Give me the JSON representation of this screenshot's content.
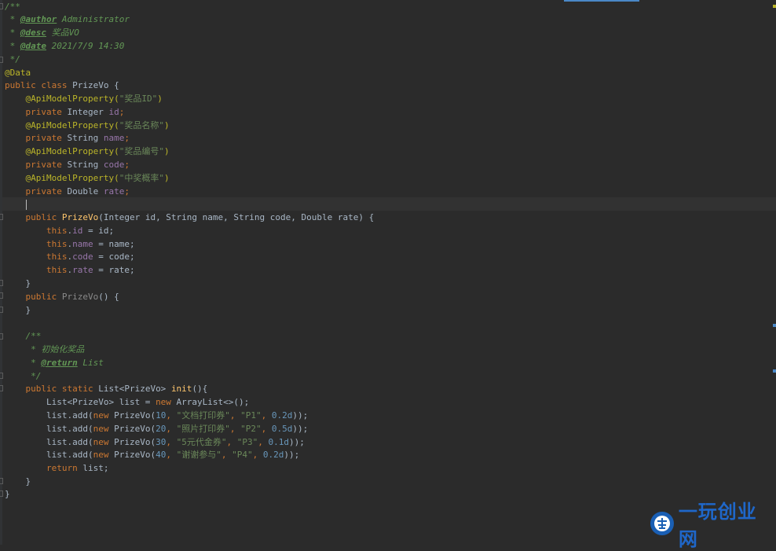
{
  "colors": {
    "background": "#2b2b2b",
    "comment": "#629755",
    "keyword": "#cc7832",
    "annotation": "#bbb529",
    "string": "#6a8759",
    "field": "#9876aa",
    "number": "#6897bb",
    "method": "#ffc66d",
    "text": "#a9b7c6"
  },
  "code": {
    "l1": "/**",
    "l2_prefix": " * ",
    "l2_tag": "@author",
    "l2_rest": " Administrator",
    "l3_prefix": " * ",
    "l3_tag": "@desc",
    "l3_rest": " 奖品VO",
    "l4_prefix": " * ",
    "l4_tag": "@date",
    "l4_rest": " 2021/7/9 14:30",
    "l5": " */",
    "l6": "@Data",
    "l7_kw": "public class",
    "l7_rest": " PrizeVo {",
    "l8_ann": "    @ApiModelProperty(",
    "l8_str": "\"奖品ID\"",
    "l8_end": ")",
    "l9_kw": "    private",
    "l9_type": " Integer ",
    "l9_field": "id",
    "l9_end": ";",
    "l10_ann": "    @ApiModelProperty(",
    "l10_str": "\"奖品名称\"",
    "l10_end": ")",
    "l11_kw": "    private",
    "l11_type": " String ",
    "l11_field": "name",
    "l11_end": ";",
    "l12_ann": "    @ApiModelProperty(",
    "l12_str": "\"奖品编号\"",
    "l12_end": ")",
    "l13_kw": "    private",
    "l13_type": " String ",
    "l13_field": "code",
    "l13_end": ";",
    "l14_ann": "    @ApiModelProperty(",
    "l14_str": "\"中奖概率\"",
    "l14_end": ")",
    "l15_kw": "    private",
    "l15_type": " Double ",
    "l15_field": "rate",
    "l15_end": ";",
    "l16_indent": "    ",
    "l17_kw": "    public ",
    "l17_fn": "PrizeVo",
    "l17_rest": "(Integer id, String name, String code, Double rate) {",
    "l18_kw": "        this",
    "l18_dot": ".",
    "l18_field": "id",
    "l18_rest": " = id;",
    "l19_kw": "        this",
    "l19_dot": ".",
    "l19_field": "name",
    "l19_rest": " = name;",
    "l20_kw": "        this",
    "l20_dot": ".",
    "l20_field": "code",
    "l20_rest": " = code;",
    "l21_kw": "        this",
    "l21_dot": ".",
    "l21_field": "rate",
    "l21_rest": " = rate;",
    "l22": "    }",
    "l23_kw": "    public ",
    "l23_fn": "PrizeVo",
    "l23_rest": "() {",
    "l24": "    }",
    "l26": "    /**",
    "l27": "     * 初始化奖品",
    "l28_prefix": "     * ",
    "l28_tag": "@return",
    "l28_rest": " List",
    "l29": "     */",
    "l30_kw": "    public static",
    "l30_type": " List<PrizeVo> ",
    "l30_fn": "init",
    "l30_rest": "(){",
    "l31_a": "        List<PrizeVo> list = ",
    "l31_kw": "new",
    "l31_b": " ArrayList<>();",
    "l32_a": "        list.add(",
    "l32_kw": "new",
    "l32_b": " PrizeVo(",
    "l32_n1": "10",
    "l32_c1": ", ",
    "l32_s1": "\"文档打印券\"",
    "l32_c2": ", ",
    "l32_s2": "\"P1\"",
    "l32_c3": ", ",
    "l32_n2": "0.2d",
    "l32_end": "));",
    "l33_a": "        list.add(",
    "l33_kw": "new",
    "l33_b": " PrizeVo(",
    "l33_n1": "20",
    "l33_c1": ", ",
    "l33_s1": "\"照片打印券\"",
    "l33_c2": ", ",
    "l33_s2": "\"P2\"",
    "l33_c3": ", ",
    "l33_n2": "0.5d",
    "l33_end": "));",
    "l34_a": "        list.add(",
    "l34_kw": "new",
    "l34_b": " PrizeVo(",
    "l34_n1": "30",
    "l34_c1": ", ",
    "l34_s1": "\"5元代金券\"",
    "l34_c2": ", ",
    "l34_s2": "\"P3\"",
    "l34_c3": ", ",
    "l34_n2": "0.1d",
    "l34_end": "));",
    "l35_a": "        list.add(",
    "l35_kw": "new",
    "l35_b": " PrizeVo(",
    "l35_n1": "40",
    "l35_c1": ", ",
    "l35_s1": "\"谢谢参与\"",
    "l35_c2": ", ",
    "l35_s2": "\"P4\"",
    "l35_c3": ", ",
    "l35_n2": "0.2d",
    "l35_end": "));",
    "l36_kw": "        return",
    "l36_rest": " list;",
    "l37": "    }",
    "l38": "}"
  },
  "watermark": {
    "text": "一玩创业网",
    "icon": "watermark-logo-icon"
  }
}
